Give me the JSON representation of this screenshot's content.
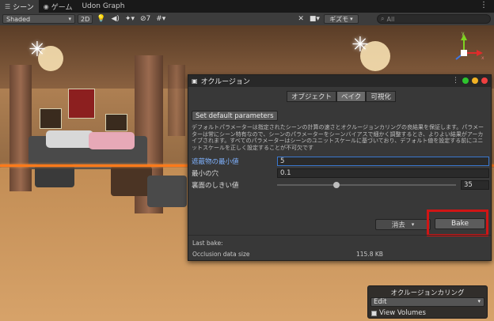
{
  "tabs": [
    {
      "label": "シーン",
      "icon": "grid-icon"
    },
    {
      "label": "ゲーム",
      "icon": "gamepad-icon"
    },
    {
      "label": "Udon Graph",
      "icon": ""
    }
  ],
  "toolbar": {
    "shading_mode": "Shaded",
    "mode_2d": "2D",
    "hidden_count": "7",
    "gizmo_label": "ギズモ",
    "search_placeholder": "All"
  },
  "occlusion_window": {
    "title": "オクルージョン",
    "tabs": [
      "オブジェクト",
      "ベイク",
      "可視化"
    ],
    "active_tab": "ベイク",
    "set_default_label": "Set default parameters",
    "description": "デフォルトパラメーターは指定されたシーンの計算の速さとオクルージョンカリングの良結果を保証します。パラメーターは常にシーン特有なので、シーンのパラメーターをシーンバイアスで細かく調整するとき、よりよい結果がアーカイブされます。すべてのパラメーターはシーンのユニットスケールに基づいており、デフォルト値を設定する前にユニットスケールを正しく設定することが不可欠です",
    "params": {
      "smallest_occluder_label": "遮蔽物の最小値",
      "smallest_occluder_value": "5",
      "smallest_hole_label": "最小の穴",
      "smallest_hole_value": "0.1",
      "backface_threshold_label": "裏面のしきい値",
      "backface_threshold_value": "35",
      "backface_threshold_fraction": 0.33
    },
    "clear_label": "消去",
    "bake_label": "Bake",
    "last_bake_label": "Last bake:",
    "occlusion_data_size_label": "Occlusion data size",
    "occlusion_data_size_value": "115.8 KB"
  },
  "overlay": {
    "title": "オクルージョンカリング",
    "mode_value": "Edit",
    "view_volumes_label": "View Volumes"
  },
  "gizmo": {
    "axis_y": "y",
    "axis_x": "x",
    "axis_z": "z"
  }
}
